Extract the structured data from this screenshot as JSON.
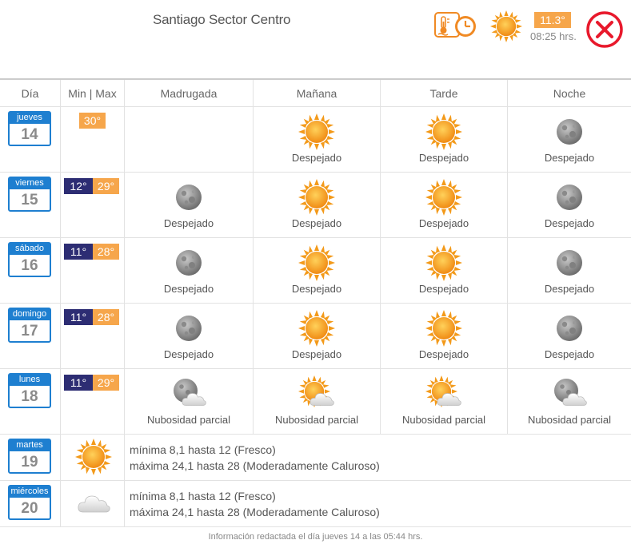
{
  "header": {
    "location": "Santiago Sector Centro",
    "current_temp": "11.3°",
    "current_time": "08:25 hrs.",
    "icons": [
      "thermometer-icon",
      "clock-icon",
      "sun-icon",
      "close-icon"
    ]
  },
  "columns": [
    "Día",
    "Min | Max",
    "Madrugada",
    "Mañana",
    "Tarde",
    "Noche"
  ],
  "days": [
    {
      "weekday": "jueves",
      "day": "14",
      "min": "",
      "max": "30°",
      "periods": [
        null,
        {
          "icon": "sun-icon",
          "label": "Despejado"
        },
        {
          "icon": "sun-icon",
          "label": "Despejado"
        },
        {
          "icon": "moon-icon",
          "label": "Despejado"
        }
      ]
    },
    {
      "weekday": "viernes",
      "day": "15",
      "min": "12°",
      "max": "29°",
      "periods": [
        {
          "icon": "moon-icon",
          "label": "Despejado"
        },
        {
          "icon": "sun-icon",
          "label": "Despejado"
        },
        {
          "icon": "sun-icon",
          "label": "Despejado"
        },
        {
          "icon": "moon-icon",
          "label": "Despejado"
        }
      ]
    },
    {
      "weekday": "sábado",
      "day": "16",
      "min": "11°",
      "max": "28°",
      "periods": [
        {
          "icon": "moon-icon",
          "label": "Despejado"
        },
        {
          "icon": "sun-icon",
          "label": "Despejado"
        },
        {
          "icon": "sun-icon",
          "label": "Despejado"
        },
        {
          "icon": "moon-icon",
          "label": "Despejado"
        }
      ]
    },
    {
      "weekday": "domingo",
      "day": "17",
      "min": "11°",
      "max": "28°",
      "periods": [
        {
          "icon": "moon-icon",
          "label": "Despejado"
        },
        {
          "icon": "sun-icon",
          "label": "Despejado"
        },
        {
          "icon": "sun-icon",
          "label": "Despejado"
        },
        {
          "icon": "moon-icon",
          "label": "Despejado"
        }
      ]
    },
    {
      "weekday": "lunes",
      "day": "18",
      "min": "11°",
      "max": "29°",
      "periods": [
        {
          "icon": "moon-cloud-icon",
          "label": "Nubosidad parcial"
        },
        {
          "icon": "sun-cloud-icon",
          "label": "Nubosidad parcial"
        },
        {
          "icon": "sun-cloud-icon",
          "label": "Nubosidad parcial"
        },
        {
          "icon": "moon-cloud-icon",
          "label": "Nubosidad parcial"
        }
      ]
    }
  ],
  "summary": [
    {
      "weekday": "martes",
      "day": "19",
      "icon": "sun-icon",
      "line1": "mínima 8,1 hasta 12 (Fresco)",
      "line2": "máxima 24,1 hasta 28 (Moderadamente Caluroso)"
    },
    {
      "weekday": "miércoles",
      "day": "20",
      "icon": "cloud-icon",
      "line1": "mínima 8,1 hasta 12 (Fresco)",
      "line2": "máxima 24,1 hasta 28 (Moderadamente Caluroso)"
    }
  ],
  "footer": "Información redactada el día jueves 14 a las 05:44 hrs.",
  "colors": {
    "calendar_blue": "#1e7fd0",
    "min_badge": "#2d2d73",
    "max_badge": "#f6a64b",
    "sun": "#f7a21b",
    "close_red": "#e8192c"
  }
}
